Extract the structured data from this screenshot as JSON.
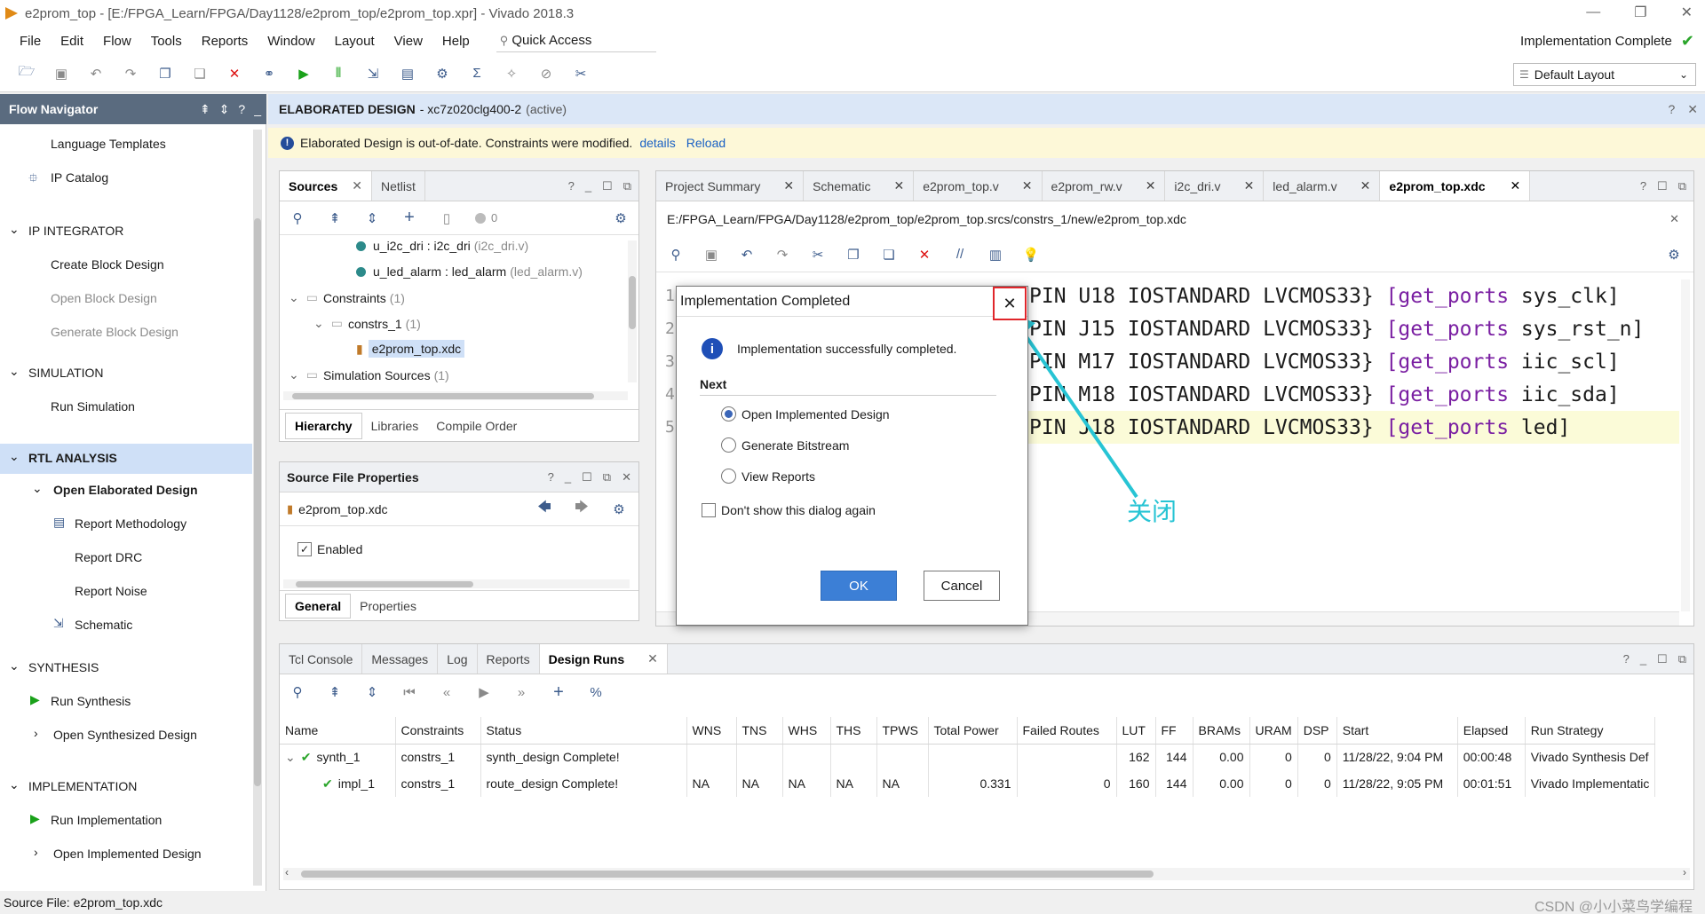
{
  "window": {
    "title": "e2prom_top - [E:/FPGA_Learn/FPGA/Day1128/e2prom_top/e2prom_top.xpr] - Vivado 2018.3",
    "status": "Implementation Complete",
    "layout": "Default Layout",
    "quick_access": "Quick Access"
  },
  "menu": [
    "File",
    "Edit",
    "Flow",
    "Tools",
    "Reports",
    "Window",
    "Layout",
    "View",
    "Help"
  ],
  "flow_navigator": {
    "title": "Flow Navigator",
    "items": {
      "language_templates": "Language Templates",
      "ip_catalog": "IP Catalog",
      "ip_integrator": "IP INTEGRATOR",
      "create_block_design": "Create Block Design",
      "open_block_design": "Open Block Design",
      "generate_block_design": "Generate Block Design",
      "simulation": "SIMULATION",
      "run_simulation": "Run Simulation",
      "rtl_analysis": "RTL ANALYSIS",
      "open_elaborated_design": "Open Elaborated Design",
      "report_methodology": "Report Methodology",
      "report_drc": "Report DRC",
      "report_noise": "Report Noise",
      "schematic": "Schematic",
      "synthesis": "SYNTHESIS",
      "run_synthesis": "Run Synthesis",
      "open_synthesized_design": "Open Synthesized Design",
      "implementation": "IMPLEMENTATION",
      "run_implementation": "Run Implementation",
      "open_implemented_design": "Open Implemented Design"
    }
  },
  "elaborated": {
    "header": "ELABORATED DESIGN",
    "part": "- xc7z020clg400-2",
    "active": "(active)",
    "banner": "Elaborated Design is out-of-date. Constraints were modified.",
    "details": "details",
    "reload": "Reload"
  },
  "sources": {
    "tabs": [
      "Sources",
      "Netlist"
    ],
    "count": "0",
    "tree": {
      "i2c_inst": "u_i2c_dri : i2c_dri",
      "i2c_file": "(i2c_dri.v)",
      "led_inst": "u_led_alarm : led_alarm",
      "led_file": "(led_alarm.v)",
      "constraints": "Constraints",
      "constraints_count": "(1)",
      "constrs_1": "constrs_1",
      "constrs_1_count": "(1)",
      "xdc": "e2prom_top.xdc",
      "sim_sources": "Simulation Sources",
      "sim_count": "(1)"
    },
    "bottom_tabs": [
      "Hierarchy",
      "Libraries",
      "Compile Order"
    ]
  },
  "source_props": {
    "title": "Source File Properties",
    "file": "e2prom_top.xdc",
    "enabled": "Enabled",
    "tabs": [
      "General",
      "Properties"
    ]
  },
  "editor": {
    "tabs": [
      "Project Summary",
      "Schematic",
      "e2prom_top.v",
      "e2prom_rw.v",
      "i2c_dri.v",
      "led_alarm.v",
      "e2prom_top.xdc"
    ],
    "path": "E:/FPGA_Learn/FPGA/Day1128/e2prom_top/e2prom_top.srcs/constrs_1/new/e2prom_top.xdc",
    "line_numbers": [
      "1",
      "2",
      "3",
      "4",
      "5"
    ],
    "lines": [
      {
        "text": "PIN U18 IOSTANDARD LVCMOS33} ",
        "cmd": "[get_ports",
        "arg": " sys_clk]"
      },
      {
        "text": "PIN J15 IOSTANDARD LVCMOS33} ",
        "cmd": "[get_ports",
        "arg": " sys_rst_n]"
      },
      {
        "text": "PIN M17 IOSTANDARD LVCMOS33} ",
        "cmd": "[get_ports",
        "arg": " iic_scl]"
      },
      {
        "text": "PIN M18 IOSTANDARD LVCMOS33} ",
        "cmd": "[get_ports",
        "arg": " iic_sda]"
      },
      {
        "text": "PIN J18 IOSTANDARD LVCMOS33} ",
        "cmd": "[get_ports",
        "arg": " led]"
      }
    ],
    "annotation": "关闭"
  },
  "dialog": {
    "title": "Implementation Completed",
    "message": "Implementation successfully completed.",
    "next": "Next",
    "options": [
      "Open Implemented Design",
      "Generate Bitstream",
      "View Reports"
    ],
    "dont_show": "Don't show this dialog again",
    "ok": "OK",
    "cancel": "Cancel"
  },
  "runs": {
    "tabs": [
      "Tcl Console",
      "Messages",
      "Log",
      "Reports",
      "Design Runs"
    ],
    "columns": [
      "Name",
      "Constraints",
      "Status",
      "WNS",
      "TNS",
      "WHS",
      "THS",
      "TPWS",
      "Total Power",
      "Failed Routes",
      "LUT",
      "FF",
      "BRAMs",
      "URAM",
      "DSP",
      "Start",
      "Elapsed",
      "Run Strategy"
    ],
    "rows": [
      [
        "synth_1",
        "constrs_1",
        "synth_design Complete!",
        "",
        "",
        "",
        "",
        "",
        "",
        "",
        "162",
        "144",
        "0.00",
        "0",
        "0",
        "11/28/22, 9:04 PM",
        "00:00:48",
        "Vivado Synthesis Def"
      ],
      [
        "impl_1",
        "constrs_1",
        "route_design Complete!",
        "NA",
        "NA",
        "NA",
        "NA",
        "NA",
        "0.331",
        "0",
        "160",
        "144",
        "0.00",
        "0",
        "0",
        "11/28/22, 9:05 PM",
        "00:01:51",
        "Vivado Implementatic"
      ]
    ]
  },
  "statusbar": {
    "source_file": "Source File: e2prom_top.xdc",
    "watermark": "CSDN @小小菜鸟学编程"
  }
}
